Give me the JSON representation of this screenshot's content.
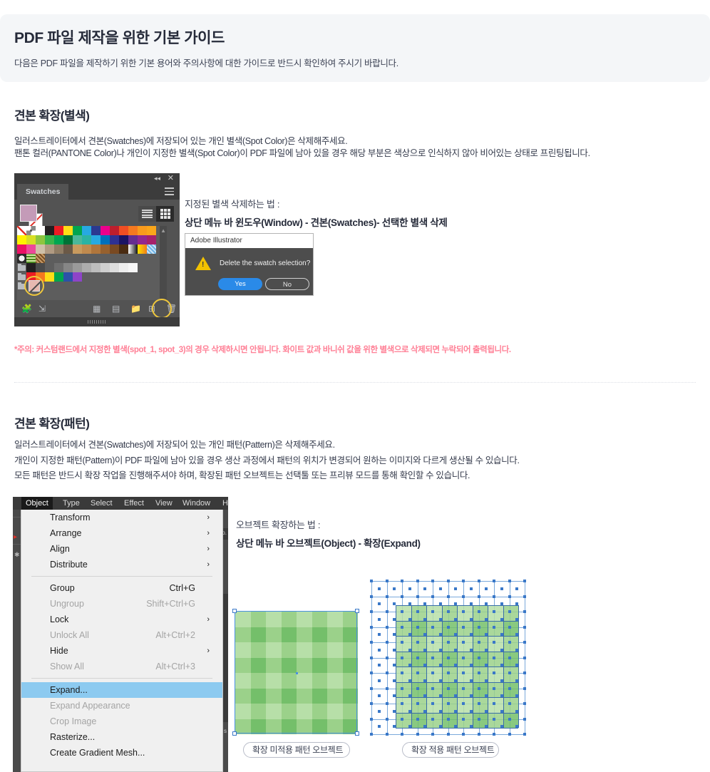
{
  "banner": {
    "title": "PDF 파일 제작을 위한 기본 가이드",
    "subtitle": "다음은 PDF 파일을 제작하기 위한 기본 용어와 주의사항에 대한 가이드로 반드시 확인하여 주시기 바랍니다."
  },
  "section_spot": {
    "title": "견본 확장(별색)",
    "paragraphs": [
      "일러스트레이터에서 견본(Swatches)에 저장되어 있는 개인 별색(Spot Color)은 삭제해주세요.",
      "팬톤 컬러(PANTONE Color)나 개인이 지정한 별색(Spot Color)이 PDF 파일에 남아 있을 경우 해당 부분은 색상으로 인식하지 않아 비어있는 상태로 프린팅됩니다."
    ],
    "callout": {
      "line1": "지정된 별색 삭제하는 법 :",
      "line2": "상단 메뉴 바 윈도우(Window) - 견본(Swatches)- 선택한 별색 삭제"
    },
    "note": "*주의: 커스텀랜드에서 지정한 별색(spot_1, spot_3)의 경우 삭제하시면 안됩니다. 화이트 값과 바니쉬 값을 위한 별색으로 삭제되면 누락되어 출력됩니다.",
    "note_color": "#ff8096"
  },
  "swatches_panel": {
    "tab_label": "Swatches",
    "fill_color": "#c49bb8",
    "view_list_label": "list-view",
    "view_grid_label": "grid-view",
    "rows": [
      [
        "none",
        "registration",
        "#ffffff",
        "#231f20",
        "#ed1c24",
        "#ffde17",
        "#00a54f",
        "#27a9e1",
        "#2b3990",
        "#ec008c",
        "#be1e2d",
        "#f04e23",
        "#f5791f",
        "#f99b1c",
        "#faa61a"
      ],
      [
        "#fff200",
        "#d7df23",
        "#8dc63f",
        "#39b54a",
        "#00a651",
        "#007236",
        "#4bb79a",
        "#2bb3a3",
        "#27aae1",
        "#0070bb",
        "#2e3192",
        "#1b1464",
        "#652d90",
        "#92278f",
        "#a6216b"
      ],
      [
        "#ec1164",
        "#ec4899",
        "#cfc0a8",
        "#b09a82",
        "#8f7c64",
        "#6b5947",
        "#c89a5e",
        "#c08a4e",
        "#b0763c",
        "#97612e",
        "#7a4a22",
        "#4a2c12",
        "gradient-white-black",
        "gradient-yellow-orange",
        "pattern-blue"
      ],
      [
        "pattern-globe",
        "pattern-green",
        "pattern-brown"
      ],
      [
        "folder",
        "#231f20",
        "#4a4a4a",
        "#5d5d5d",
        "#6e6e6e",
        "#868686",
        "#9a9a9a",
        "#adadad",
        "#bdbdbd",
        "#cfcfcf",
        "#dedede",
        "#eeeeee",
        "#f7f7f7"
      ],
      [
        "folder",
        "#ed1c24",
        "#f5791f",
        "#ffde17",
        "#00a54f",
        "#2b52a8",
        "#8e44c8"
      ],
      [
        "folder",
        "spot-selected"
      ]
    ],
    "highlight_color": "#f0c83c",
    "bottom_icons": [
      "library-icon",
      "load-swatches-icon",
      "swatch-group-icon",
      "list-icon",
      "folder-icon",
      "new-swatch-icon",
      "trash-icon"
    ]
  },
  "ai_dialog": {
    "title": "Adobe Illustrator",
    "message": "Delete the swatch selection?",
    "yes_label": "Yes",
    "no_label": "No",
    "yes_color": "#2a8ae8"
  },
  "section_pattern": {
    "title": "견본 확장(패턴)",
    "paragraphs": [
      "일러스트레이터에서 견본(Swatches)에 저장되어 있는 개인 패턴(Pattern)은 삭제해주세요.",
      "개인이 지정한 패턴(Pattern)이 PDF 파일에 남아 있을 경우 생산 과정에서 패턴의 위치가 변경되어 원하는 이미지와 다르게 생산될 수 있습니다.",
      "모든 패턴은 반드시 확장 작업을 진행해주셔야 하며, 확장된 패턴 오브젝트는 선택툴 또는 프리뷰 모드를 통해 확인할 수 있습니다."
    ],
    "callout": {
      "line1": "오브젝트 확장하는 법 :",
      "line2": "상단 메뉴 바 오브젝트(Object) - 확장(Expand)"
    },
    "caption_left": "확장 미적용 패턴 오브젝트",
    "caption_right": "확장 적용 패턴 오브젝트"
  },
  "object_menu": {
    "menubar": [
      "Object",
      "Type",
      "Select",
      "Effect",
      "View",
      "Window",
      "H"
    ],
    "menubar_selected": "Object",
    "items": [
      {
        "label": "Transform",
        "shortcut": "",
        "submenu": true,
        "disabled": false,
        "highlighted": false
      },
      {
        "label": "Arrange",
        "shortcut": "",
        "submenu": true,
        "disabled": false,
        "highlighted": false
      },
      {
        "label": "Align",
        "shortcut": "",
        "submenu": true,
        "disabled": false,
        "highlighted": false
      },
      {
        "label": "Distribute",
        "shortcut": "",
        "submenu": true,
        "disabled": false,
        "highlighted": false
      },
      {
        "separator": true
      },
      {
        "label": "Group",
        "shortcut": "Ctrl+G",
        "submenu": false,
        "disabled": false,
        "highlighted": false
      },
      {
        "label": "Ungroup",
        "shortcut": "Shift+Ctrl+G",
        "submenu": false,
        "disabled": true,
        "highlighted": false
      },
      {
        "label": "Lock",
        "shortcut": "",
        "submenu": true,
        "disabled": false,
        "highlighted": false
      },
      {
        "label": "Unlock All",
        "shortcut": "Alt+Ctrl+2",
        "submenu": false,
        "disabled": true,
        "highlighted": false
      },
      {
        "label": "Hide",
        "shortcut": "",
        "submenu": true,
        "disabled": false,
        "highlighted": false
      },
      {
        "label": "Show All",
        "shortcut": "Alt+Ctrl+3",
        "submenu": false,
        "disabled": true,
        "highlighted": false
      },
      {
        "separator": true
      },
      {
        "label": "Expand...",
        "shortcut": "",
        "submenu": false,
        "disabled": false,
        "highlighted": true
      },
      {
        "label": "Expand Appearance",
        "shortcut": "",
        "submenu": false,
        "disabled": true,
        "highlighted": false
      },
      {
        "label": "Crop Image",
        "shortcut": "",
        "submenu": false,
        "disabled": true,
        "highlighted": false
      },
      {
        "label": "Rasterize...",
        "shortcut": "",
        "submenu": false,
        "disabled": false,
        "highlighted": false
      },
      {
        "label": "Create Gradient Mesh...",
        "shortcut": "",
        "submenu": false,
        "disabled": false,
        "highlighted": false
      }
    ],
    "highlight_color": "#8ccaf0"
  },
  "pattern_figure": {
    "light_green": "#b7dfa8",
    "mid_green": "#9bd18a",
    "dark_green": "#74bf6a",
    "selection_blue": "#4a90e2",
    "anchor_blue": "#3a78c8"
  }
}
